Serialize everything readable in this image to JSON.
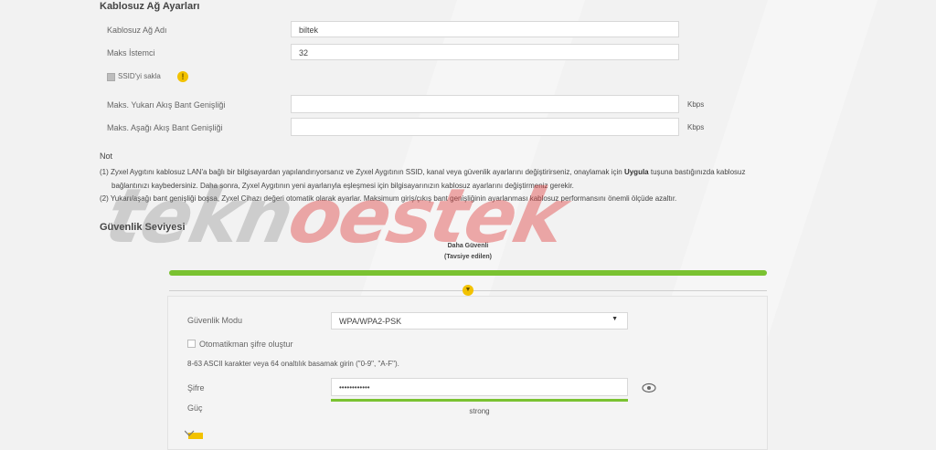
{
  "wireless": {
    "title": "Kablosuz Ağ Ayarları",
    "ssid_label": "Kablosuz Ağ Adı",
    "ssid_value": "biltek",
    "max_clients_label": "Maks İstemci",
    "max_clients_value": "32",
    "hide_ssid_label": "SSID'yi sakla",
    "info_icon": "info-icon",
    "upstream_label": "Maks. Yukarı Akış Bant Genişliği",
    "upstream_value": "",
    "upstream_unit": "Kbps",
    "downstream_label": "Maks. Aşağı Akış Bant Genişliği",
    "downstream_value": "",
    "downstream_unit": "Kbps"
  },
  "note": {
    "title": "Not",
    "line1_pre": "(1) Zyxel Aygıtını kablosuz LAN'a bağlı bir bilgisayardan yapılandırıyorsanız ve Zyxel Aygıtının SSID, kanal veya güvenlik ayarlarını değiştirirseniz, onaylamak için ",
    "line1_bold": "Uygula",
    "line1_post": " tuşuna bastığınızda kablosuz",
    "line2": "bağlantınızı kaybedersiniz. Daha sonra, Zyxel Aygıtının yeni ayarlarıyla eşleşmesi için bilgisayarınızın kablosuz ayarlarını değiştirmeniz gerekir.",
    "line3": "(2) Yukarı/aşağı bant genişliği boşsa, Zyxel Cihazı değeri otomatik olarak ayarlar. Maksimum giriş/çıkış bant genişliğinin ayarlanması kablosuz performansını önemli ölçüde azaltır."
  },
  "security": {
    "title": "Güvenlik Seviyesi",
    "level_title": "Daha Güvenli",
    "level_subtitle": "(Tavsiye edilen)",
    "level_fraction": 1.0,
    "mode_label": "Güvenlik Modu",
    "mode_value": "WPA/WPA2-PSK",
    "auto_password_label": "Otomatikman şifre oluştur",
    "hint": "8-63 ASCII karakter veya 64 onaltılık basamak girin (\"0-9\", \"A-F\").",
    "password_label": "Şifre",
    "password_value": "••••••••••••",
    "strength_label": "Güç",
    "strength_value": "strong"
  },
  "watermark": {
    "text_a": "tekn",
    "text_b": "o",
    "text_c": "estek"
  },
  "colors": {
    "accent_green": "#7ac231",
    "accent_yellow": "#f2c200",
    "watermark_red": "#e14646"
  }
}
